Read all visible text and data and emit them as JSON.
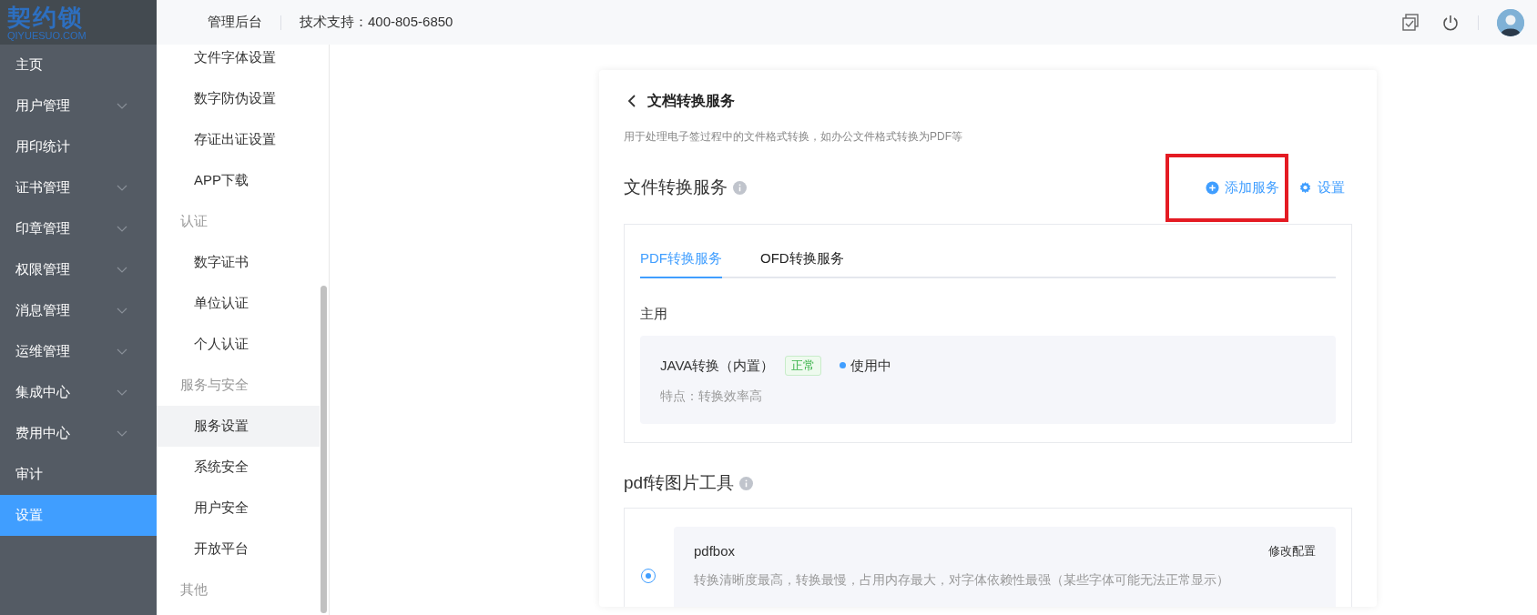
{
  "logo": {
    "name": "契约锁",
    "domain": "QIYUESUO.COM"
  },
  "header": {
    "title": "管理后台",
    "support": "技术支持：400-805-6850"
  },
  "main_nav": [
    {
      "label": "主页",
      "expandable": false,
      "selected": false
    },
    {
      "label": "用户管理",
      "expandable": true,
      "selected": false
    },
    {
      "label": "用印统计",
      "expandable": false,
      "selected": false
    },
    {
      "label": "证书管理",
      "expandable": true,
      "selected": false
    },
    {
      "label": "印章管理",
      "expandable": true,
      "selected": false
    },
    {
      "label": "权限管理",
      "expandable": true,
      "selected": false
    },
    {
      "label": "消息管理",
      "expandable": true,
      "selected": false
    },
    {
      "label": "运维管理",
      "expandable": true,
      "selected": false
    },
    {
      "label": "集成中心",
      "expandable": true,
      "selected": false
    },
    {
      "label": "费用中心",
      "expandable": true,
      "selected": false
    },
    {
      "label": "审计",
      "expandable": false,
      "selected": false
    },
    {
      "label": "设置",
      "expandable": false,
      "selected": true
    }
  ],
  "sub_nav": [
    {
      "kind": "item",
      "label": "文件字体设置",
      "selected": false
    },
    {
      "kind": "item",
      "label": "数字防伪设置",
      "selected": false
    },
    {
      "kind": "item",
      "label": "存证出证设置",
      "selected": false
    },
    {
      "kind": "item",
      "label": "APP下载",
      "selected": false
    },
    {
      "kind": "group",
      "label": "认证"
    },
    {
      "kind": "item",
      "label": "数字证书",
      "selected": false
    },
    {
      "kind": "item",
      "label": "单位认证",
      "selected": false
    },
    {
      "kind": "item",
      "label": "个人认证",
      "selected": false
    },
    {
      "kind": "group",
      "label": "服务与安全"
    },
    {
      "kind": "item",
      "label": "服务设置",
      "selected": true
    },
    {
      "kind": "item",
      "label": "系统安全",
      "selected": false
    },
    {
      "kind": "item",
      "label": "用户安全",
      "selected": false
    },
    {
      "kind": "item",
      "label": "开放平台",
      "selected": false
    },
    {
      "kind": "group",
      "label": "其他"
    }
  ],
  "page": {
    "title": "文档转换服务",
    "description": "用于处理电子签过程中的文件格式转换，如办公文件格式转换为PDF等",
    "section": {
      "title": "文件转换服务",
      "actions": [
        {
          "kind": "add",
          "label": "添加服务",
          "highlighted": true
        },
        {
          "kind": "settings",
          "label": "设置",
          "highlighted": false
        }
      ],
      "tabs": [
        {
          "label": "PDF转换服务",
          "selected": true
        },
        {
          "label": "OFD转换服务",
          "selected": false
        }
      ],
      "group_label": "主用",
      "services": [
        {
          "name": "JAVA转换（内置）",
          "tag": "正常",
          "status": "使用中",
          "feature": "特点：转换效率高"
        }
      ]
    },
    "tool_section": {
      "title": "pdf转图片工具",
      "options": [
        {
          "name": "pdfbox",
          "action": "修改配置",
          "description": "转换清晰度最高，转换最慢，占用内存最大，对字体依赖性最强（某些字体可能无法正常显示）",
          "selected": true
        }
      ]
    }
  }
}
